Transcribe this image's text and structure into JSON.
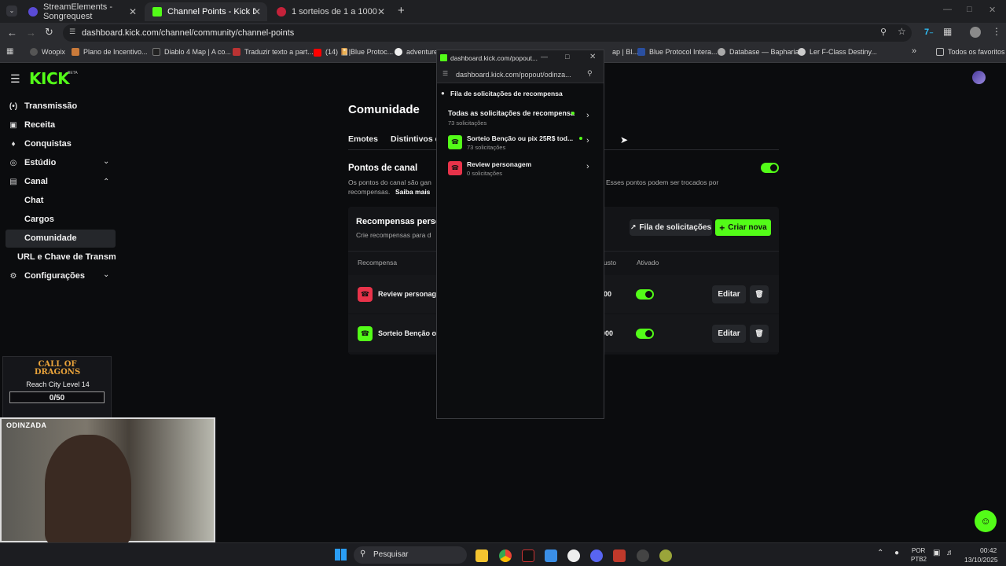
{
  "browser": {
    "tabs": [
      {
        "title": "StreamElements - Songrequest",
        "color": "#5a4bd6"
      },
      {
        "title": "Channel Points - Kick Dashboard",
        "color": "#53fc18"
      },
      {
        "title": "1 sorteios de 1 a 1000 - Gerador",
        "color": "#c4223a"
      }
    ],
    "url": "dashboard.kick.com/channel/community/channel-points",
    "bookmarks": [
      "Woopix",
      "Plano de Incentivo...",
      "Diablo 4 Map | A co...",
      "Traduzir texto a part...",
      "(14) 📔|Blue Protoc...",
      "adventurer",
      "ap | Bl...",
      "Blue Protocol Intera...",
      "Database — Bapharia",
      "Ler F-Class Destiny..."
    ],
    "all_favorites": "Todos os favoritos"
  },
  "sidebar": {
    "logo": "KICK",
    "logo_badge": "BETA",
    "items": [
      {
        "label": "Transmissão",
        "icon": "broadcast-icon"
      },
      {
        "label": "Receita",
        "icon": "revenue-icon"
      },
      {
        "label": "Conquistas",
        "icon": "trophy-icon"
      },
      {
        "label": "Estúdio",
        "icon": "studio-icon"
      },
      {
        "label": "Canal",
        "icon": "channel-icon"
      },
      {
        "label": "Configurações",
        "icon": "gear-icon"
      }
    ],
    "subitems": [
      "Chat",
      "Cargos",
      "Comunidade"
    ],
    "url_key": "URL e Chave de Transmissão"
  },
  "overlay": {
    "game": "CALL OF DRAGONS",
    "goal_label": "Reach City Level 14",
    "goal_progress": "0/50",
    "streamer": "ODINZADA"
  },
  "main": {
    "title": "Comunidade",
    "tabs": [
      "Emotes",
      "Distintivos d"
    ],
    "points_title": "Pontos de canal",
    "points_desc_left": "Os pontos do canal são gan",
    "points_desc_right": "Esses pontos podem ser trocados por",
    "points_desc_line2": "recompensas.",
    "learn_more": "Saiba mais",
    "rewards_title": "Recompensas perso",
    "rewards_desc": "Crie recompensas para d",
    "queue_button": "Fila de solicitações",
    "create_button": "Criar nova",
    "col_reward": "Recompensa",
    "col_cost": "usto",
    "col_enabled": "Ativado",
    "rows": [
      {
        "name": "Review personage",
        "cost": "00",
        "color": "#e8334a",
        "edit": "Editar"
      },
      {
        "name": "Sorteio Benção ou",
        "cost": "000",
        "color": "#53fc18",
        "edit": "Editar"
      }
    ]
  },
  "popup": {
    "window_title": "dashboard.kick.com/popout...",
    "url": "dashboard.kick.com/popout/odinza...",
    "header": "Fila de solicitações de recompensa",
    "requests": [
      {
        "title": "Todas as solicitações de recompensa",
        "count": "73 solicitações"
      },
      {
        "title": "Sorteio Benção ou pix 25R$ tod...",
        "count": "73 solicitações"
      },
      {
        "title": "Review personagem",
        "count": "0 solicitações"
      }
    ]
  },
  "taskbar": {
    "search": "Pesquisar",
    "lang": "POR",
    "layout": "PTB2",
    "time": "00:42",
    "date": "13/10/2025"
  }
}
